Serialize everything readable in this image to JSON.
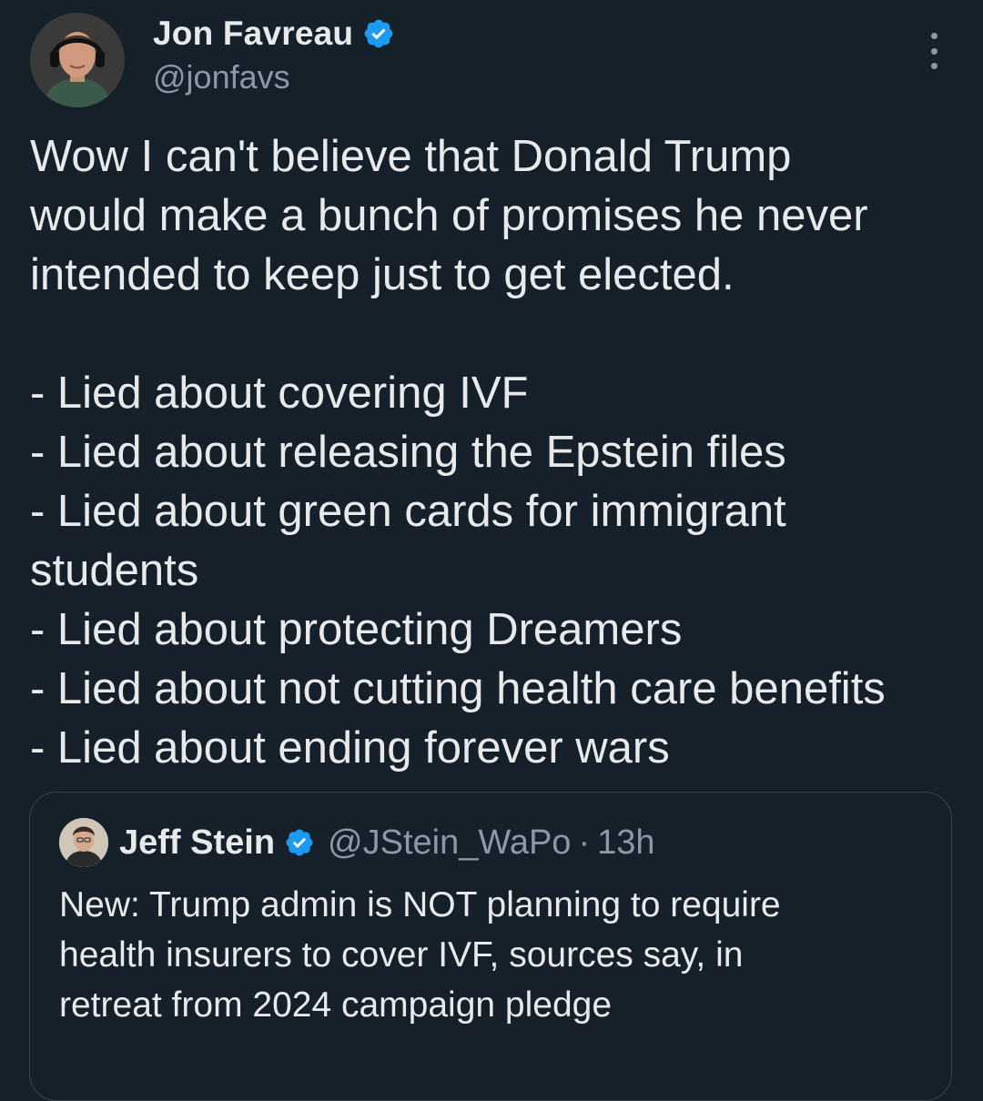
{
  "author": {
    "display_name": "Jon Favreau",
    "handle": "@jonfavs",
    "avatar_icon": "profile-photo-avatar",
    "verified_icon": "verified-badge-icon",
    "verified_color": "#1d9bf0"
  },
  "more_icon": "more-options-icon",
  "tweet": {
    "lines": [
      "Wow I can't believe that Donald Trump",
      "would make a bunch of promises he never",
      "intended to keep just to get elected.",
      "",
      "- Lied about covering IVF",
      "- Lied about releasing the Epstein files",
      "- Lied about green cards for immigrant",
      "students",
      "- Lied about protecting Dreamers",
      "- Lied about not cutting health care benefits",
      "- Lied about ending forever wars"
    ]
  },
  "quoted": {
    "display_name": "Jeff Stein",
    "handle": "@JStein_WaPo",
    "separator": "·",
    "time": "13h",
    "lines": [
      "New: Trump admin is NOT planning to require",
      "health insurers to cover IVF, sources say, in",
      "retreat from 2024 campaign pledge"
    ]
  },
  "colors": {
    "background": "#15202b",
    "text": "#e7e9ea",
    "secondary_text": "#8b98a5",
    "border": "#38444d"
  }
}
